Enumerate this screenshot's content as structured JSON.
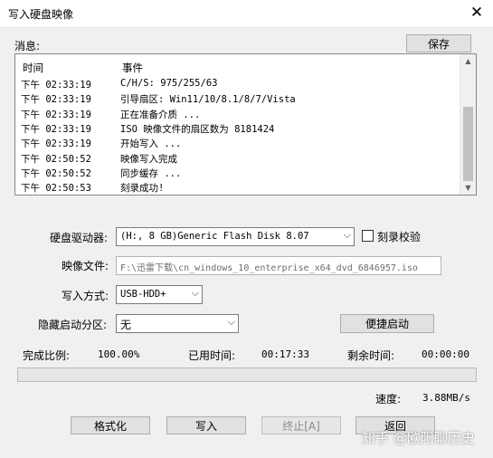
{
  "window": {
    "title": "写入硬盘映像",
    "close_glyph": "✕"
  },
  "message_label": "消息:",
  "save_button": "保存",
  "log": {
    "headers": {
      "time": "时间",
      "event": "事件"
    },
    "rows": [
      {
        "time": "下午 02:33:19",
        "event": "C/H/S: 975/255/63"
      },
      {
        "time": "下午 02:33:19",
        "event": "引导扇区: Win11/10/8.1/8/7/Vista"
      },
      {
        "time": "下午 02:33:19",
        "event": "正在准备介质 ..."
      },
      {
        "time": "下午 02:33:19",
        "event": "ISO 映像文件的扇区数为 8181424"
      },
      {
        "time": "下午 02:33:19",
        "event": "开始写入 ..."
      },
      {
        "time": "下午 02:50:52",
        "event": "映像写入完成"
      },
      {
        "time": "下午 02:50:52",
        "event": "同步缓存 ..."
      },
      {
        "time": "下午 02:50:53",
        "event": "刻录成功!"
      }
    ]
  },
  "drive": {
    "label": "硬盘驱动器:",
    "value": "(H:, 8 GB)Generic Flash Disk        8.07"
  },
  "verify": {
    "label": "刻录校验",
    "checked": false
  },
  "image_file": {
    "label": "映像文件:",
    "value": "F:\\迅雷下载\\cn_windows_10_enterprise_x64_dvd_6846957.iso"
  },
  "write_mode": {
    "label": "写入方式:",
    "value": "USB-HDD+"
  },
  "hidden_partition": {
    "label": "隐藏启动分区:",
    "value": "无"
  },
  "quick_boot_button": "便捷启动",
  "stats": {
    "complete_label": "完成比例:",
    "complete_value": "100.00%",
    "elapsed_label": "已用时间:",
    "elapsed_value": "00:17:33",
    "remaining_label": "剩余时间:",
    "remaining_value": "00:00:00",
    "speed_label": "速度:",
    "speed_value": "3.88MB/s"
  },
  "progress_fraction": 0,
  "buttons": {
    "format": "格式化",
    "write": "写入",
    "abort": "终止[A]",
    "back": "返回"
  },
  "watermark": "知乎 @欧阳聊历史",
  "icons": {
    "dropdown": "chevron-down-icon",
    "scroll_up": "arrow-up-icon",
    "scroll_down": "arrow-down-icon"
  }
}
